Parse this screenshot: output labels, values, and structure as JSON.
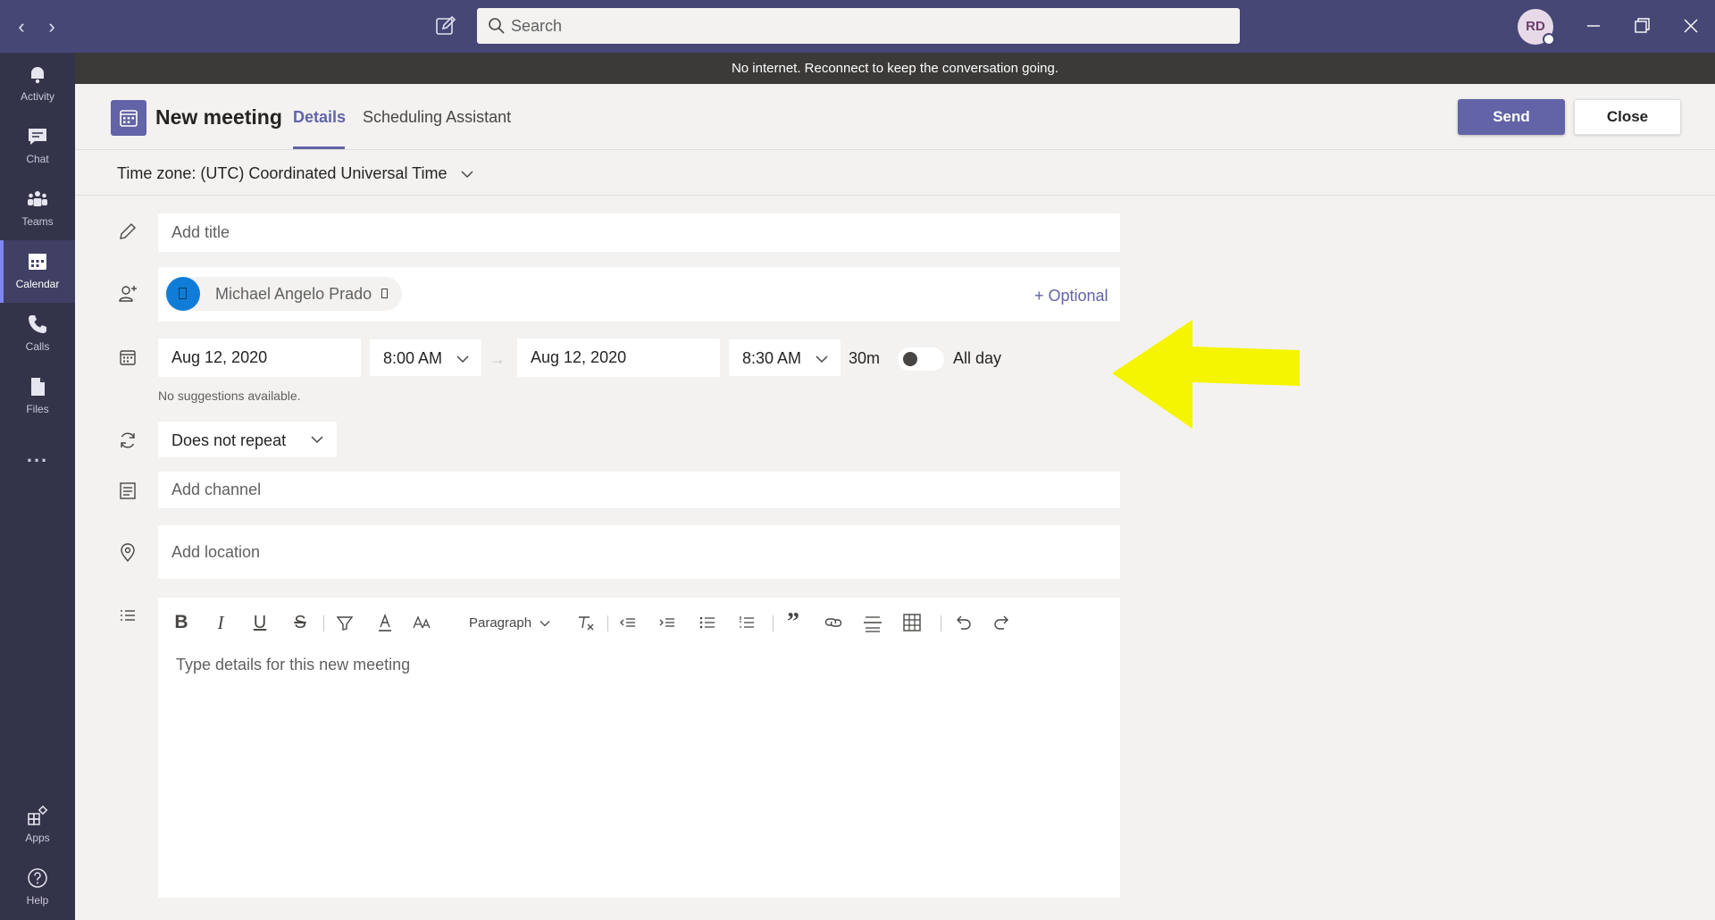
{
  "titlebar": {
    "search_placeholder": "Search",
    "avatar_initials": "RD"
  },
  "banner": {
    "text": "No internet. Reconnect to keep the conversation going."
  },
  "rail": {
    "items": [
      {
        "label": "Activity",
        "icon": "bell-icon"
      },
      {
        "label": "Chat",
        "icon": "chat-icon"
      },
      {
        "label": "Teams",
        "icon": "teams-icon"
      },
      {
        "label": "Calendar",
        "icon": "calendar-icon",
        "active": true
      },
      {
        "label": "Calls",
        "icon": "phone-icon"
      },
      {
        "label": "Files",
        "icon": "file-icon"
      }
    ],
    "more": "...",
    "bottom": [
      {
        "label": "Apps",
        "icon": "apps-icon"
      },
      {
        "label": "Help",
        "icon": "help-icon"
      }
    ]
  },
  "header": {
    "title": "New meeting",
    "tabs": [
      "Details",
      "Scheduling Assistant"
    ],
    "send_label": "Send",
    "close_label": "Close"
  },
  "timezone": {
    "label": "Time zone: (UTC) Coordinated Universal Time"
  },
  "form": {
    "title_placeholder": "Add title",
    "attendee_name": "Michael Angelo Prado",
    "optional_label": "+ Optional",
    "start_date": "Aug 12, 2020",
    "start_time": "8:00 AM",
    "end_date": "Aug 12, 2020",
    "end_time": "8:30 AM",
    "duration": "30m",
    "all_day_label": "All day",
    "all_day_on": false,
    "suggestions": "No suggestions available.",
    "repeat": "Does not repeat",
    "channel_placeholder": "Add channel",
    "location_placeholder": "Add location"
  },
  "editor": {
    "paragraph_label": "Paragraph",
    "placeholder": "Type details for this new meeting"
  },
  "colors": {
    "brand": "#6264a7",
    "titlebar": "#464775",
    "rail": "#33344a",
    "annotation": "#f5f500"
  }
}
